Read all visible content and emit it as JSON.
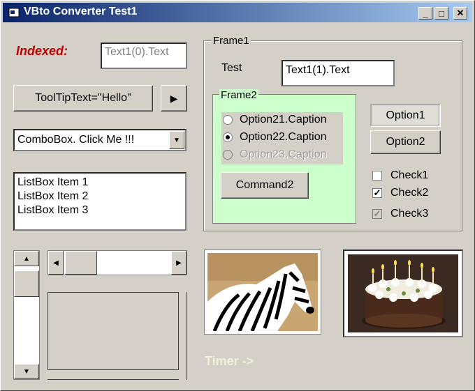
{
  "window": {
    "title": "VBto Converter Test1",
    "min_label": "_",
    "max_label": "□",
    "close_label": "✕"
  },
  "indexed_label": "Indexed:",
  "text1_0": "Text1(0).Text",
  "tooltip_button": "ToolTipText=\"Hello\"",
  "arrow_button": "▶",
  "combo": {
    "value": "ComboBox.  Click Me !!!"
  },
  "listbox": {
    "items": [
      "ListBox Item 1",
      "ListBox Item 2",
      "ListBox Item 3"
    ]
  },
  "frame1": {
    "label": "Frame1",
    "test_label": "Test",
    "text1_1": "Text1(1).Text"
  },
  "frame2": {
    "label": "Frame2",
    "options": [
      {
        "label": "Option21.Caption",
        "selected": false,
        "enabled": true
      },
      {
        "label": "Option22.Caption",
        "selected": true,
        "enabled": true
      },
      {
        "label": "Option23.Caption",
        "selected": false,
        "enabled": false
      }
    ],
    "command_label": "Command2",
    "bg_color": "#ccffcc"
  },
  "option_buttons": [
    "Option1",
    "Option2"
  ],
  "checks": [
    {
      "label": "Check1",
      "checked": false,
      "enabled": true
    },
    {
      "label": "Check2",
      "checked": true,
      "enabled": true
    },
    {
      "label": "Check3",
      "checked": true,
      "enabled": false
    }
  ],
  "timer_label": "Timer ->",
  "colors": {
    "indexed": "#c00000",
    "timer": "#f0f0d8"
  }
}
